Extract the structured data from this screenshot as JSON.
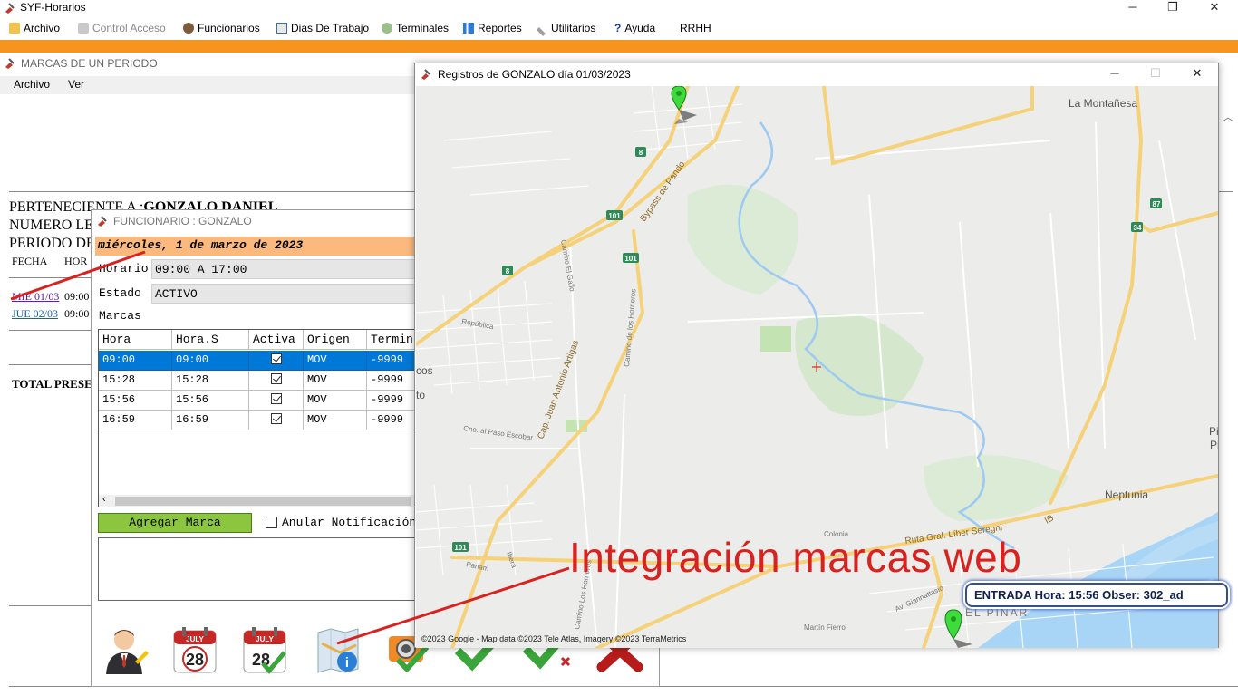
{
  "app": {
    "title": "SYF-Horarios",
    "controls": {
      "minimize": "─",
      "restore": "❐",
      "close": "✕"
    }
  },
  "menubar": [
    {
      "label": "Archivo",
      "icon": "folder-icon",
      "enabled": true
    },
    {
      "label": "Control Acceso",
      "icon": "lock-icon",
      "enabled": false
    },
    {
      "label": "Funcionarios",
      "icon": "people-icon",
      "enabled": true
    },
    {
      "label": "Dias De Trabajo",
      "icon": "calendar-icon",
      "enabled": true
    },
    {
      "label": "Terminales",
      "icon": "terminal-icon",
      "enabled": true
    },
    {
      "label": "Reportes",
      "icon": "report-icon",
      "enabled": true
    },
    {
      "label": "Utilitarios",
      "icon": "tools-icon",
      "enabled": true
    },
    {
      "label": "Ayuda",
      "icon": "help-icon",
      "enabled": true
    },
    {
      "label": "RRHH",
      "icon": "",
      "enabled": true
    }
  ],
  "periodo": {
    "title": "MARCAS DE UN PERIODO",
    "menu": [
      "Archivo",
      "Ver"
    ],
    "report": {
      "perteneciente_label": "PERTENECIENTE A :",
      "perteneciente_value": "GONZALO DANIEL",
      "numero_label": "NUMERO LE",
      "periodo_label": "PERIODO DE",
      "col_fecha": "FECHA",
      "col_hora": "HOR",
      "rows": [
        {
          "date": "MIE 01/03",
          "time": "09:00"
        },
        {
          "date": "JUE 02/03",
          "time": "09:00"
        }
      ],
      "total": "TOTAL PRESE"
    }
  },
  "funcionario": {
    "title": "FUNCIONARIO : GONZALO",
    "date": "miércoles, 1 de marzo de 2023",
    "horario_label": "Horario",
    "horario_value": "09:00 A 17:00",
    "estado_label": "Estado",
    "estado_value": "ACTIVO",
    "marcas_label": "Marcas",
    "columns": [
      "Hora",
      "Hora.S",
      "Activa",
      "Origen",
      "Termin"
    ],
    "rows": [
      {
        "hora": "09:00",
        "hora_s": "09:00",
        "activa": true,
        "origen": "MOV",
        "terminal": "-9999",
        "selected": true
      },
      {
        "hora": "15:28",
        "hora_s": "15:28",
        "activa": true,
        "origen": "MOV",
        "terminal": "-9999",
        "selected": false
      },
      {
        "hora": "15:56",
        "hora_s": "15:56",
        "activa": true,
        "origen": "MOV",
        "terminal": "-9999",
        "selected": false
      },
      {
        "hora": "16:59",
        "hora_s": "16:59",
        "activa": true,
        "origen": "MOV",
        "terminal": "-9999",
        "selected": false
      }
    ],
    "agregar_label": "Agregar Marca",
    "anular_label": "Anular Notificación",
    "toolbar": [
      "user-edit-icon",
      "calendar-28-icon",
      "calendar-check-icon",
      "map-info-icon",
      "camera-check-icon",
      "check-icon",
      "check-cross-icon",
      "delete-icon"
    ]
  },
  "map": {
    "title": "Registros de GONZALO  día 01/03/2023",
    "attribution": "©2023 Google - Map data ©2023 Tele Atlas, Imagery ©2023 TerraMetrics",
    "callout": "ENTRADA Hora: 15:56 Obser: 302_ad",
    "places": {
      "montanesa": "La Montañesa",
      "neptunia": "Neptunia",
      "pinar": "EL PINAR",
      "bypass": "Bypass de Pando",
      "artigas": "Cap. Juan Antonio Artigas",
      "gallo": "Camino El Gallo",
      "horneros": "Camino de los Horneros",
      "horneros2": "Camino Los Horneros",
      "paso_escobar": "Cno. al Paso Escobar",
      "ruta": "Ruta Gral. Líber Seregni",
      "giannattasio": "Av. Giannattasio",
      "republica": "República",
      "colonia": "Colonia",
      "panam": "Panam",
      "ibera": "Iberá",
      "martin_fierro": "Martín Fierro",
      "pi": "Pi",
      "cos": "cos",
      "to": "to",
      "ib": "IB"
    },
    "route_badges": [
      "8",
      "101",
      "101",
      "8",
      "101",
      "34",
      "87"
    ]
  },
  "overlay_caption": "Integración marcas web",
  "colors": {
    "accent": "#f7941d",
    "selection": "#0078d7",
    "button_green": "#8cc63f",
    "annotation_red": "#d9221f",
    "date_band": "#fbb97e"
  }
}
